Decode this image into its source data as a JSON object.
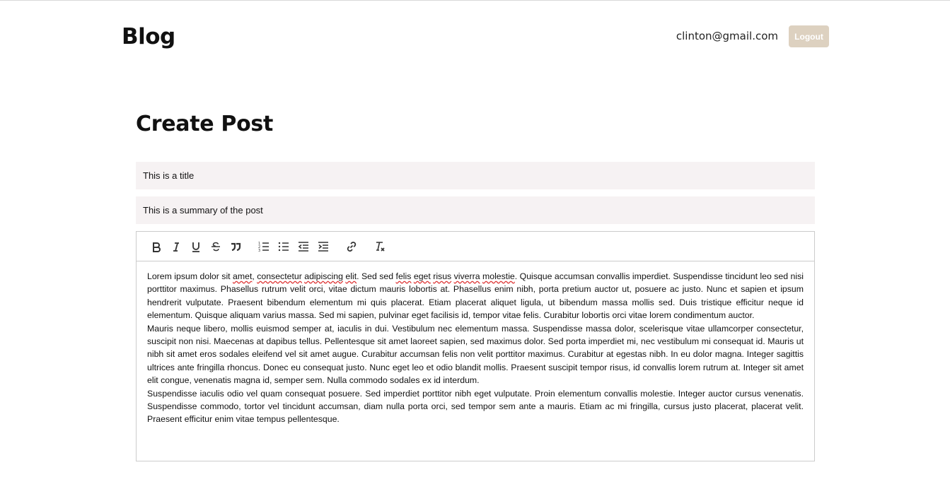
{
  "header": {
    "brand": "Blog",
    "user_email": "clinton@gmail.com",
    "logout_label": "Logout"
  },
  "page": {
    "title": "Create Post"
  },
  "form": {
    "title_value": "This is a title",
    "summary_value": "This is a summary of the post"
  },
  "toolbar": {
    "buttons": [
      "bold-icon",
      "italic-icon",
      "underline-icon",
      "strikethrough-icon",
      "blockquote-icon",
      "ordered-list-icon",
      "bullet-list-icon",
      "outdent-icon",
      "indent-icon",
      "link-icon",
      "clear-format-icon"
    ]
  },
  "editor": {
    "p1_a": "Lorem ipsum dolor sit ",
    "p1_w1": "amet",
    "p1_b": ", ",
    "p1_w2": "consectetur",
    "p1_c": " ",
    "p1_w3": "adipiscing",
    "p1_d": " ",
    "p1_w4": "elit",
    "p1_e": ". Sed sed ",
    "p1_w5": "felis",
    "p1_f": " ",
    "p1_w6": "eget",
    "p1_g": " ",
    "p1_w7": "risus",
    "p1_h": " ",
    "p1_w8": "viverra",
    "p1_i": " ",
    "p1_w9": "molestie",
    "p1_rest": ". Quisque accumsan convallis imperdiet. Suspendisse tincidunt leo sed nisi porttitor maximus. Phasellus rutrum velit orci, vitae dictum mauris lobortis at. Phasellus enim nibh, porta pretium auctor ut, posuere ac justo. Nunc et sapien et ipsum hendrerit vulputate. Praesent bibendum elementum mi quis placerat. Etiam placerat aliquet ligula, ut bibendum massa mollis sed. Duis tristique efficitur neque id elementum. Quisque aliquam varius massa. Sed mi sapien, pulvinar eget facilisis id, tempor vitae felis. Curabitur lobortis orci vitae lorem condimentum auctor.",
    "p2": "Mauris neque libero, mollis euismod semper at, iaculis in dui. Vestibulum nec elementum massa. Suspendisse massa dolor, scelerisque vitae ullamcorper consectetur, suscipit non nisi. Maecenas at dapibus tellus. Pellentesque sit amet laoreet sapien, sed maximus dolor. Sed porta imperdiet mi, nec vestibulum mi consequat id. Mauris ut nibh sit amet eros sodales eleifend vel sit amet augue. Curabitur accumsan felis non velit porttitor maximus. Curabitur at egestas nibh. In eu dolor magna. Integer sagittis ultrices ante fringilla rhoncus. Donec eu consequat justo. Nunc eget leo et odio blandit mollis. Praesent suscipit tempor risus, id convallis lorem rutrum at. Integer sit amet elit congue, venenatis magna id, semper sem. Nulla commodo sodales ex id interdum.",
    "p3": "Suspendisse iaculis odio vel quam consequat posuere. Sed imperdiet porttitor nibh eget vulputate. Proin elementum convallis molestie. Integer auctor cursus venenatis. Suspendisse commodo, tortor vel tincidunt accumsan, diam nulla porta orci, sed tempor sem ante a mauris. Etiam ac mi fringilla, cursus justo placerat, placerat velit. Praesent efficitur enim vitae tempus pellentesque."
  }
}
